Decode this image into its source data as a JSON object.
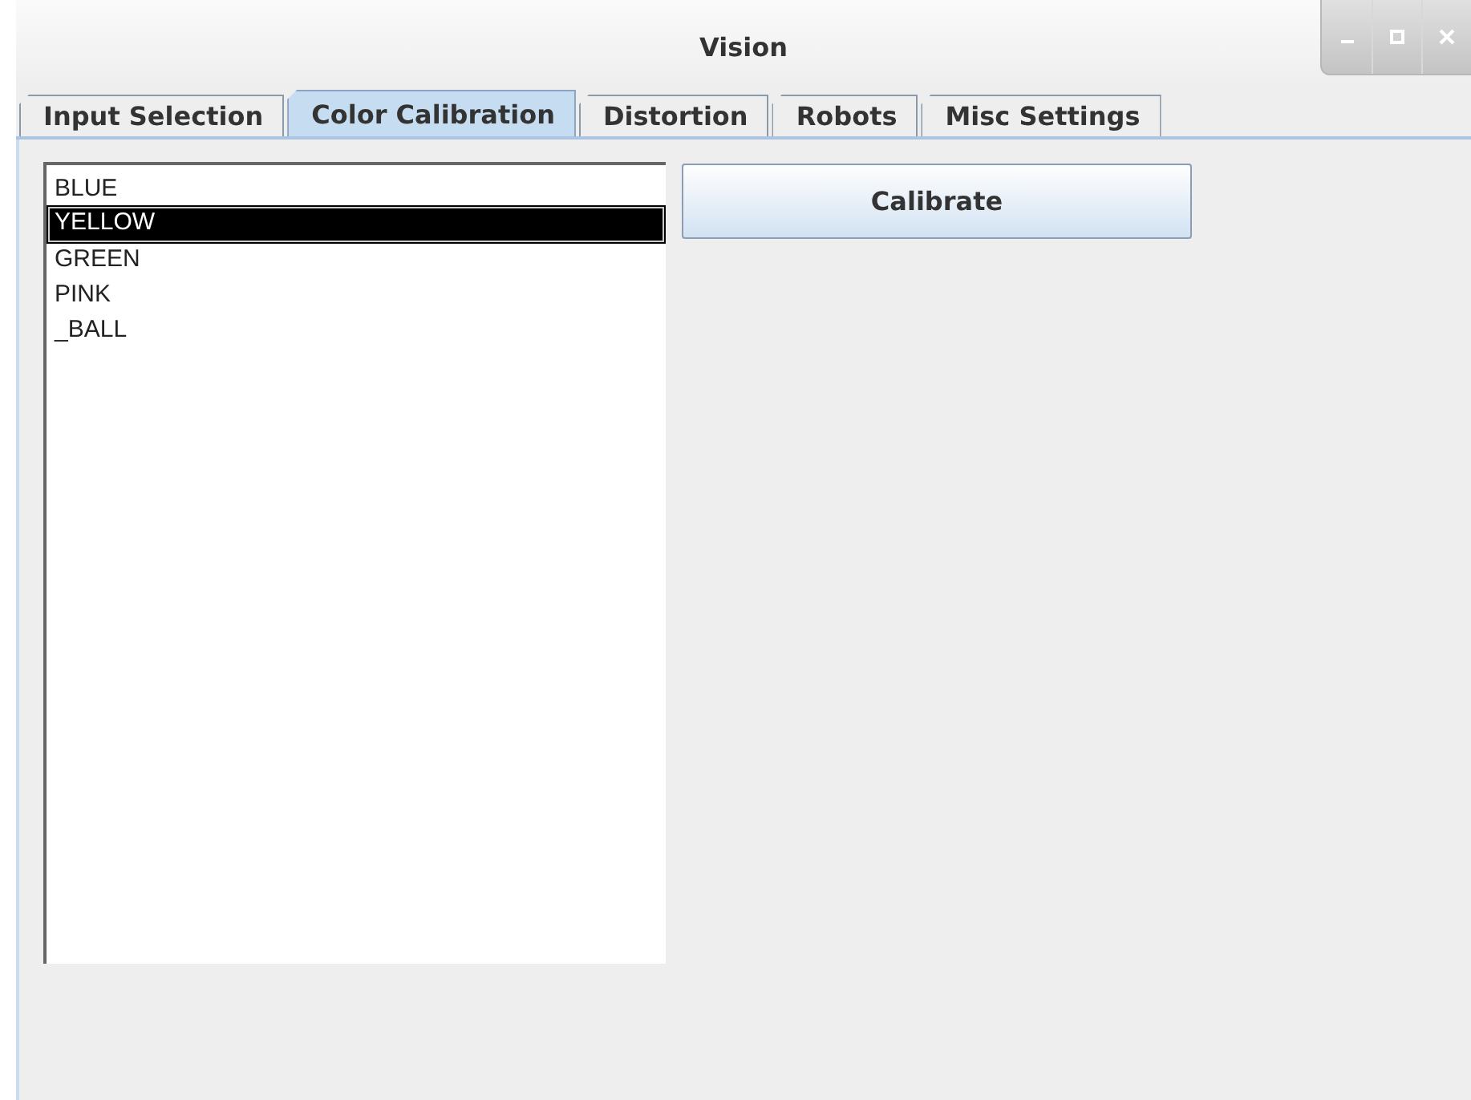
{
  "window": {
    "title": "Vision"
  },
  "tabs": [
    {
      "label": "Input Selection",
      "selected": false
    },
    {
      "label": "Color Calibration",
      "selected": true
    },
    {
      "label": "Distortion",
      "selected": false
    },
    {
      "label": "Robots",
      "selected": false
    },
    {
      "label": "Misc Settings",
      "selected": false
    }
  ],
  "color_list": [
    {
      "label": "BLUE",
      "selected": false
    },
    {
      "label": "YELLOW",
      "selected": true
    },
    {
      "label": "GREEN",
      "selected": false
    },
    {
      "label": "PINK",
      "selected": false
    },
    {
      "label": "_BALL",
      "selected": false
    }
  ],
  "calibrate_button": "Calibrate"
}
